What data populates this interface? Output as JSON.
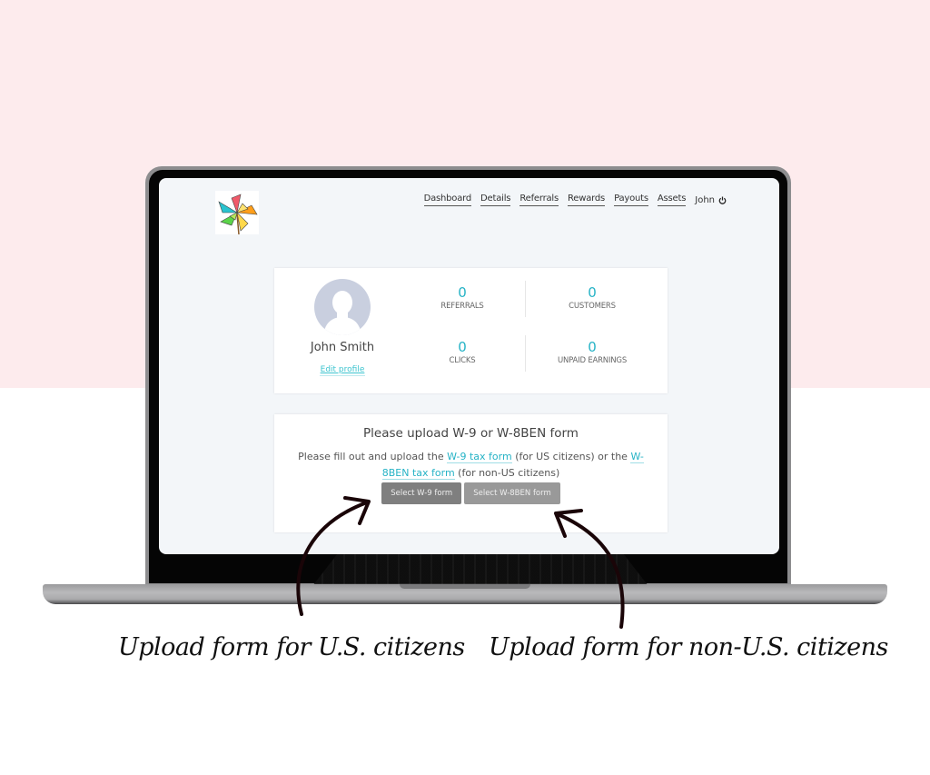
{
  "colors": {
    "background_top": "#fdebed",
    "accent": "#26b3c6",
    "button_primary": "#7f7f7f",
    "button_secondary": "#999999"
  },
  "nav": {
    "items": [
      {
        "label": "Dashboard"
      },
      {
        "label": "Details"
      },
      {
        "label": "Referrals"
      },
      {
        "label": "Rewards"
      },
      {
        "label": "Payouts"
      },
      {
        "label": "Assets"
      }
    ],
    "user_label": "John",
    "logout_icon": "power-icon"
  },
  "logo": {
    "icon": "pinwheel-logo"
  },
  "profile": {
    "name": "John Smith",
    "edit_link": "Edit profile",
    "avatar_icon": "user-silhouette-icon"
  },
  "stats": [
    {
      "value": "0",
      "label": "REFERRALS"
    },
    {
      "value": "0",
      "label": "CUSTOMERS"
    },
    {
      "value": "0",
      "label": "CLICKS"
    },
    {
      "value": "0",
      "label": "UNPAID EARNINGS"
    }
  ],
  "upload": {
    "title": "Please upload W-9 or W-8BEN form",
    "text_1": "Please fill out and upload the ",
    "link_w9": "W-9 tax form",
    "text_2": " (for US citizens) or the ",
    "link_w8": "W-8BEN tax form",
    "text_3": " (for non-US citizens)",
    "button_w9": "Select W-9 form",
    "button_w8": "Select W-8BEN form"
  },
  "annotations": {
    "left": "Upload form for U.S. citizens",
    "right": "Upload form for non-U.S. citizens"
  }
}
